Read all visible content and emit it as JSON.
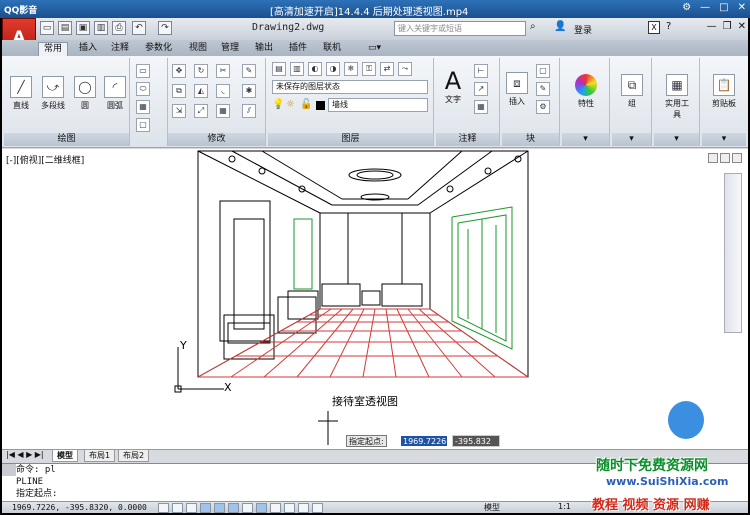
{
  "player": {
    "app_name": "QQ影音",
    "title": "[高清加速开启]14.4.4 后期处理透视图.mp4"
  },
  "autocad": {
    "doc_title": "Drawing2.dwg",
    "search_placeholder": "键入关键字或短语",
    "login_label": "登录",
    "tabs": [
      "常用",
      "插入",
      "注释",
      "参数化",
      "视图",
      "管理",
      "输出",
      "插件",
      "联机"
    ],
    "active_tab": "常用",
    "panels": {
      "draw": {
        "label": "绘图",
        "tools": [
          "直线",
          "多段线",
          "圆",
          "圆弧"
        ]
      },
      "modify": {
        "label": "修改"
      },
      "layers": {
        "label": "图层",
        "layer_state": "未保存的图层状态",
        "current_layer": "墙线"
      },
      "annotation": {
        "label": "注释",
        "tool": "文字"
      },
      "block": {
        "label": "块",
        "tool": "插入"
      },
      "properties": {
        "tool": "特性"
      },
      "group": {
        "tool": "组"
      },
      "utilities": {
        "tool": "实用工具"
      },
      "clipboard": {
        "tool": "剪贴板"
      }
    },
    "viewport_label": "[-][俯视][二维线框]",
    "drawing_caption": "接待室透视图",
    "prompt": {
      "label": "指定起点:",
      "value_x": "1969.7226",
      "value_y": "-395.832"
    },
    "axis_x": "X",
    "axis_y": "Y",
    "layout_tabs": [
      "模型",
      "布局1",
      "布局2"
    ],
    "active_layout": "模型",
    "command_history": [
      "命令: pl",
      "PLINE",
      "指定起点:"
    ],
    "status": {
      "coordinates": "1969.7226, -395.8320, 0.0000",
      "model_label": "模型",
      "scale": "1:1"
    }
  },
  "watermark": {
    "line1": "随时下免费资源网",
    "line2": "教程 视频 资源 网赚",
    "site": "www.SuiShiXia.com"
  },
  "colors": {
    "accent_red": "#d22a1a",
    "floor_grid": "#d63a3a",
    "door_green": "#1a9a2a",
    "selection_blue": "#1e52a5"
  }
}
